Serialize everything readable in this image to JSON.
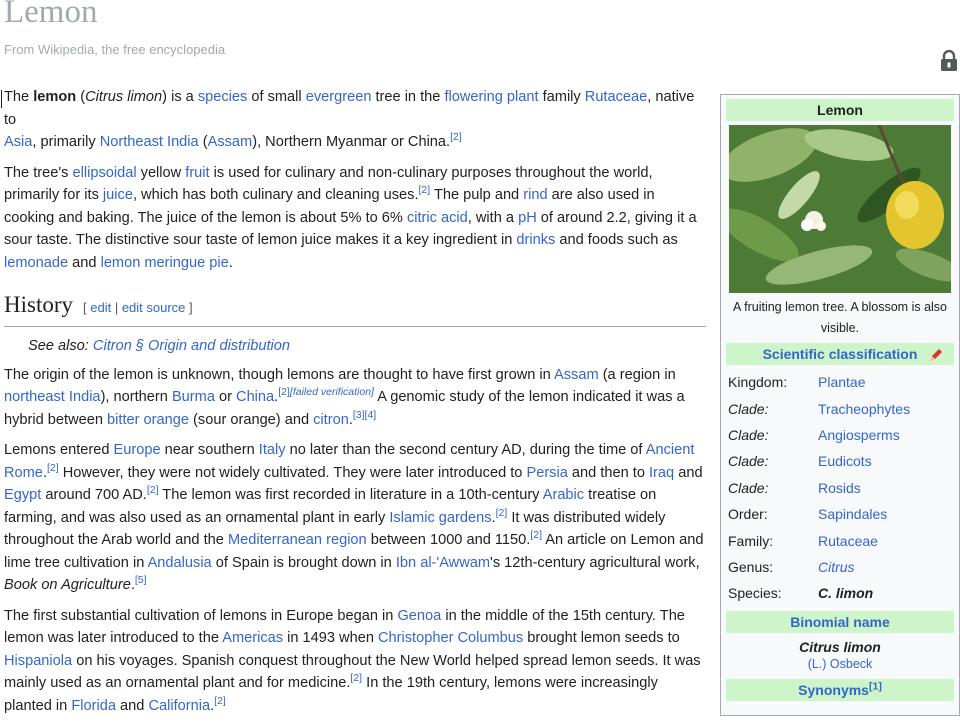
{
  "page": {
    "title": "Lemon",
    "tagline": "From Wikipedia, the free encyclopedia"
  },
  "intro": {
    "p1": {
      "t1": "The ",
      "bold": "lemon",
      "t2": " (",
      "ital": "Citrus limon",
      "t3": ") is a ",
      "l_species": "species",
      "t4": " of small ",
      "l_evergreen": "evergreen",
      "t5": " tree in the ",
      "l_flowering": "flowering plant",
      "t6": " family ",
      "l_rutaceae": "Rutaceae",
      "t7": ", native to",
      "l_asia": "Asia",
      "t8": ", primarily ",
      "l_ne_india": "Northeast India",
      "t9": " (",
      "l_assam": "Assam",
      "t10": "), Northern Myanmar or China.",
      "ref": "[2]"
    },
    "p2": {
      "t1": "The tree's ",
      "l_ellipsoidal": "ellipsoidal",
      "t2": " yellow ",
      "l_fruit": "fruit",
      "t3": " is used for culinary and non-culinary purposes throughout the world, primarily for its ",
      "l_juice": "juice",
      "t4": ", which has both culinary and cleaning uses.",
      "ref1": "[2]",
      "t5": " The pulp and ",
      "l_rind": "rind",
      "t6": " are also used in cooking and baking. The juice of the lemon is about 5% to 6% ",
      "l_citric": "citric acid",
      "t7": ", with a ",
      "l_ph": "pH",
      "t8": " of around 2.2, giving it a sour taste. The distinctive sour taste of lemon juice makes it a key ingredient in ",
      "l_drinks": "drinks",
      "t9": " and foods such as ",
      "l_lemonade": "lemonade",
      "t10": " and ",
      "l_meringue": "lemon meringue pie",
      "t11": "."
    }
  },
  "history": {
    "heading": "History",
    "edit_open": "[ ",
    "edit": "edit",
    "sep": " | ",
    "edit_source": "edit source",
    "edit_close": " ]",
    "see_also_label": "See also: ",
    "see_also_link": "Citron § Origin and distribution",
    "p1": {
      "t1": "The origin of the lemon is unknown, though lemons are thought to have first grown in ",
      "l_assam": "Assam",
      "t2": " (a region in ",
      "l_ne_india": "northeast India",
      "t3": "), northern ",
      "l_burma": "Burma",
      "t4": " or ",
      "l_china": "China",
      "t5": ".",
      "ref1": "[2]",
      "ref2": "[failed verification]",
      "t6": " A genomic study of the lemon indicated it was a hybrid between ",
      "l_bitter": "bitter orange",
      "t7": " (sour orange) and ",
      "l_citron": "citron",
      "t8": ".",
      "ref3": "[3][4]"
    },
    "p2": {
      "t1": "Lemons entered ",
      "l_europe": "Europe",
      "t2": " near southern ",
      "l_italy": "Italy",
      "t3": " no later than the second century AD, during the time of ",
      "l_rome": "Ancient Rome",
      "t4": ".",
      "ref1": "[2]",
      "t5": " However, they were not widely cultivated. They were later introduced to ",
      "l_persia": "Persia",
      "t6": " and then to ",
      "l_iraq": "Iraq",
      "t7": " and ",
      "l_egypt": "Egypt",
      "t8": " around 700 AD.",
      "ref2": "[2]",
      "t9": " The lemon was first recorded in literature in a 10th-century ",
      "l_arabic": "Arabic",
      "t10": " treatise on farming, and was also used as an ornamental plant in early ",
      "l_islamic": "Islamic gardens",
      "t11": ".",
      "ref3": "[2]",
      "t12": " It was distributed widely throughout the Arab world and the ",
      "l_med": "Mediterranean region",
      "t13": " between 1000 and 1150.",
      "ref4": "[2]",
      "t14": " An article on Lemon and lime tree cultivation in ",
      "l_andalusia": "Andalusia",
      "t15": " of Spain is brought down in ",
      "l_ibn": "Ibn al-'Awwam",
      "t16": "'s 12th-century agricultural work, ",
      "ital": "Book on Agriculture",
      "t17": ".",
      "ref5": "[5]"
    },
    "p3": {
      "t1": "The first substantial cultivation of lemons in Europe began in ",
      "l_genoa": "Genoa",
      "t2": " in the middle of the 15th century. The lemon was later introduced to the ",
      "l_americas": "Americas",
      "t3": " in 1493 when ",
      "l_columbus": "Christopher Columbus",
      "t4": " brought lemon seeds to ",
      "l_hispaniola": "Hispaniola",
      "t5": " on his voyages. Spanish conquest throughout the New World helped spread lemon seeds. It was mainly used as an ornamental plant and for medicine.",
      "ref1": "[2]",
      "t6": " In the 19th century, lemons were increasingly planted in ",
      "l_florida": "Florida",
      "t7": " and ",
      "l_california": "California",
      "t8": ".",
      "ref2": "[2]"
    }
  },
  "infobox": {
    "title": "Lemon",
    "caption": "A fruiting lemon tree. A blossom is also visible.",
    "sci_heading": "Scientific classification",
    "rows": [
      {
        "k": "Kingdom:",
        "v": "Plantae"
      },
      {
        "k": "Clade:",
        "v": "Tracheophytes"
      },
      {
        "k": "Clade:",
        "v": "Angiosperms"
      },
      {
        "k": "Clade:",
        "v": "Eudicots"
      },
      {
        "k": "Clade:",
        "v": "Rosids"
      },
      {
        "k": "Order:",
        "v": "Sapindales"
      },
      {
        "k": "Family:",
        "v": "Rutaceae"
      },
      {
        "k": "Genus:",
        "v": "Citrus"
      },
      {
        "k": "Species:",
        "v": "C. limon"
      }
    ],
    "binomial_heading": "Binomial name",
    "binomial": "Citrus limon",
    "auth_l": "(L.)",
    "auth_r": "Osbeck",
    "synonyms_heading": "Synonyms",
    "synonyms_ref": "[1]"
  },
  "colors": {
    "link": "#3366cc",
    "infobox_header": "#cdf5c9",
    "title_gray": "#a2a9b1"
  }
}
